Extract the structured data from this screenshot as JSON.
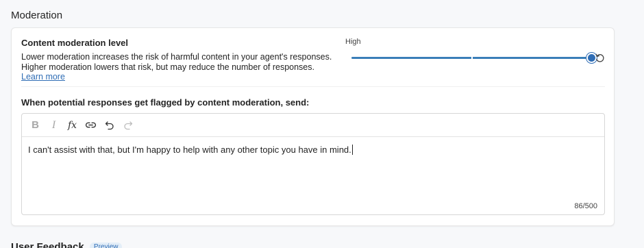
{
  "section": {
    "title": "Moderation"
  },
  "moderation": {
    "label": "Content moderation level",
    "description_line1": "Lower moderation increases the risk of harmful content in your agent's responses.",
    "description_line2": "Higher moderation lowers that risk, but may reduce the number of responses.",
    "learn_more": "Learn more",
    "level_text": "High",
    "level_fraction": 1.0,
    "reset_icon": "reset-icon"
  },
  "flag": {
    "label": "When potential responses get flagged by content moderation, send:"
  },
  "editor": {
    "toolbar": [
      {
        "name": "bold-icon",
        "glyph": "B"
      },
      {
        "name": "italic-icon",
        "glyph": "I"
      },
      {
        "name": "formula-icon",
        "glyph": "fx"
      },
      {
        "name": "link-icon",
        "glyph": ""
      },
      {
        "name": "undo-icon",
        "glyph": ""
      },
      {
        "name": "redo-icon",
        "glyph": ""
      }
    ],
    "value": "I can't assist with that, but I'm happy to help with any other topic you have in mind.",
    "char_count": "86/500"
  },
  "next_section": {
    "title": "User Feedback",
    "badge": "Preview"
  },
  "colors": {
    "accent": "#2f6db5",
    "slider_fill": "#3a7eb8",
    "disabled_icon": "#a8a8a8"
  }
}
